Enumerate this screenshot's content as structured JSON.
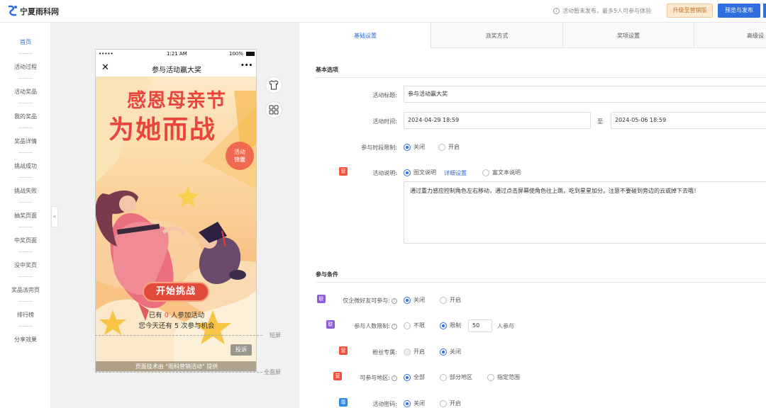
{
  "app": {
    "logo_text": "宁夏雨科网"
  },
  "header": {
    "notice": "活动暂未发布，最多5人可参与体验",
    "upgrade_button": "升级至营销版",
    "publish_button": "预览与发布"
  },
  "sidebar": {
    "items": [
      {
        "label": "首页"
      },
      {
        "label": "活动过程"
      },
      {
        "label": "活动奖品"
      },
      {
        "label": "我的奖品"
      },
      {
        "label": "奖品详情"
      },
      {
        "label": "挑战成功"
      },
      {
        "label": "挑战失败"
      },
      {
        "label": "抽奖页面"
      },
      {
        "label": "中奖页面"
      },
      {
        "label": "没中奖页"
      },
      {
        "label": "奖品派完页"
      },
      {
        "label": "排行榜"
      },
      {
        "label": "分享效果"
      }
    ]
  },
  "collapse": "«",
  "phone": {
    "status": {
      "carrier": "•••••",
      "time": "1:21 AM",
      "battery": "100%"
    },
    "nav": {
      "close": "✕",
      "title": "参与活动赢大奖",
      "more": "•••"
    },
    "poster": {
      "title_line1": "感恩母亲节",
      "title_line2": "为她而战",
      "stamp_line1": "活动",
      "stamp_line2": "锦囊",
      "start_button": "开始挑战",
      "participants_prefix": "已有",
      "participants_count": "0",
      "participants_suffix": "人参加活动",
      "chances_prefix": "您今天还有",
      "chances_count": "5",
      "chances_suffix": "次参与机会",
      "report_button": "投诉",
      "footer": "页面技术由 \"雨科营销活动\" 提供"
    }
  },
  "preview_marks": {
    "short_screen": "短屏",
    "full_screen": "全面屏"
  },
  "config": {
    "tabs": [
      {
        "label": "基础设置"
      },
      {
        "label": "派奖方式"
      },
      {
        "label": "奖项设置"
      },
      {
        "label": "高级设"
      }
    ],
    "basic": {
      "section_title": "基本选项",
      "title_label": "活动标题:",
      "title_value": "参与活动赢大奖",
      "time_label": "活动时间:",
      "start_time": "2024-04-29 18:59",
      "to": "至",
      "end_time": "2024-05-06 18:59",
      "period_label": "参与时段限制:",
      "period_options": [
        "关闭",
        "开启"
      ],
      "desc_badge": "营",
      "desc_label": "活动说明:",
      "desc_options": [
        "图文说明",
        "富文本说明"
      ],
      "desc_detail_link": "详细设置",
      "desc_text": "通过重力感应控制角色左右移动，通过点击屏幕使角色往上跳，吃到星星加分。注意不要碰到旁边的云或掉下去哦！"
    },
    "conditions": {
      "section_title": "参与条件",
      "wechat_badge": "联",
      "wechat_label": "仅企微好友可参与:",
      "wechat_options": [
        "关闭",
        "开启"
      ],
      "limit_badge": "联",
      "limit_label": "参与人数限制:",
      "limit_options": [
        "不限",
        "限制"
      ],
      "limit_value": "50",
      "limit_unit": "人参与",
      "fans_badge": "营",
      "fans_label": "粉丝专属:",
      "fans_options": [
        "开启",
        "关闭"
      ],
      "region_badge": "营",
      "region_label": "可参与地区:",
      "region_options": [
        "全部",
        "部分地区",
        "指定范围"
      ],
      "password_badge": "尊",
      "password_label": "活动密码:",
      "password_options": [
        "关闭",
        "开启"
      ]
    }
  },
  "colors": {
    "primary": "#2f6de1",
    "lianhe_badge": "#8c5cd8",
    "marketing_badge": "#f0503c",
    "vip_badge": "#2f8be1"
  }
}
